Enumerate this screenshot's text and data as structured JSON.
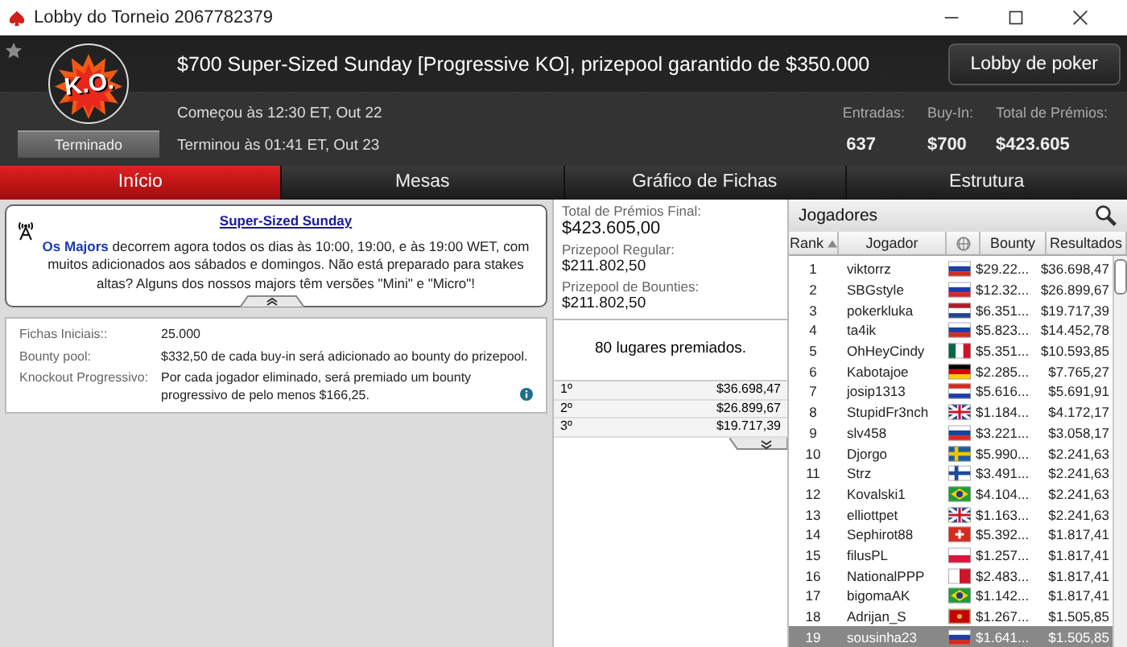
{
  "window": {
    "title": "Lobby do Torneio 2067782379"
  },
  "header": {
    "logo_text": "K.O.",
    "status": "Terminado",
    "title": "$700 Super-Sized Sunday [Progressive KO], prizepool garantido de $350.000",
    "lobby_button": "Lobby de poker",
    "started": "Começou às 12:30 ET, Out 22",
    "ended": "Terminou às 01:41 ET, Out 23",
    "stats": [
      {
        "label": "Entradas:",
        "value": "637"
      },
      {
        "label": "Buy-In:",
        "value": "$700"
      },
      {
        "label": "Total de Prémios:",
        "value": "$423.605"
      }
    ]
  },
  "tabs": [
    {
      "label": "Início",
      "selected": true
    },
    {
      "label": "Mesas",
      "selected": false
    },
    {
      "label": "Gráfico de Fichas",
      "selected": false
    },
    {
      "label": "Estrutura",
      "selected": false
    }
  ],
  "news": {
    "title": "Super-Sized Sunday",
    "link": "Os Majors",
    "text": " decorrem agora todos os dias às 10:00, 19:00, e às 19:00 WET, com muitos adicionados aos sábados e domingos. Não está preparado para stakes altas? Alguns dos nossos majors têm versões \"Mini\" e \"Micro\"!"
  },
  "details": [
    {
      "label": "Fichas Iniciais::",
      "value": "25.000",
      "info": false
    },
    {
      "label": "Bounty pool:",
      "value": "$332,50 de cada buy-in será adicionado ao bounty do prizepool.",
      "info": false
    },
    {
      "label": "Knockout Progressivo:",
      "value": "Por cada jogador eliminado, será premiado um bounty progressivo de pelo menos $166,25.",
      "info": true
    }
  ],
  "prizes": {
    "summary": [
      {
        "label": "Total de Prémios Final:",
        "value": "$423.605,00"
      },
      {
        "label": "Prizepool Regular:",
        "value": "$211.802,50"
      },
      {
        "label": "Prizepool de Bounties:",
        "value": "$211.802,50"
      }
    ],
    "places": "80 lugares premiados.",
    "payouts": [
      {
        "place": "1º",
        "amount": "$36.698,47"
      },
      {
        "place": "2º",
        "amount": "$26.899,67"
      },
      {
        "place": "3º",
        "amount": "$19.717,39"
      }
    ]
  },
  "players": {
    "title": "Jogadores",
    "columns": [
      "Rank",
      "Jogador",
      "Bounty",
      "Resultados"
    ],
    "rows": [
      {
        "rank": "1",
        "name": "viktorrz",
        "kind": "ru",
        "bounty": "$29.22...",
        "result": "$36.698,47",
        "selected": false
      },
      {
        "rank": "2",
        "name": "SBGstyle",
        "kind": "ru",
        "bounty": "$12.32...",
        "result": "$26.899,67",
        "selected": false
      },
      {
        "rank": "3",
        "name": "pokerkluka",
        "kind": "nl",
        "bounty": "$6.351...",
        "result": "$19.717,39",
        "selected": false
      },
      {
        "rank": "4",
        "name": "ta4ik",
        "kind": "ru",
        "bounty": "$5.823...",
        "result": "$14.452,78",
        "selected": false
      },
      {
        "rank": "5",
        "name": "OhHeyCindy",
        "kind": "mx",
        "bounty": "$5.351...",
        "result": "$10.593,85",
        "selected": false
      },
      {
        "rank": "6",
        "name": "Kabotajoe",
        "kind": "de",
        "bounty": "$2.285...",
        "result": "$7.765,27",
        "selected": false
      },
      {
        "rank": "7",
        "name": "josip1313",
        "kind": "hr",
        "bounty": "$5.616...",
        "result": "$5.691,91",
        "selected": false
      },
      {
        "rank": "8",
        "name": "StupidFr3nch",
        "kind": "gb",
        "bounty": "$1.184...",
        "result": "$4.172,17",
        "selected": false
      },
      {
        "rank": "9",
        "name": "slv458",
        "kind": "ru",
        "bounty": "$3.221...",
        "result": "$3.058,17",
        "selected": false
      },
      {
        "rank": "10",
        "name": "Djorgo",
        "kind": "se",
        "bounty": "$5.990...",
        "result": "$2.241,63",
        "selected": false
      },
      {
        "rank": "11",
        "name": "Strz",
        "kind": "fi",
        "bounty": "$3.491...",
        "result": "$2.241,63",
        "selected": false
      },
      {
        "rank": "12",
        "name": "Kovalski1",
        "kind": "br",
        "bounty": "$4.104...",
        "result": "$2.241,63",
        "selected": false
      },
      {
        "rank": "13",
        "name": "elliottpet",
        "kind": "gb",
        "bounty": "$1.163...",
        "result": "$2.241,63",
        "selected": false
      },
      {
        "rank": "14",
        "name": "Sephirot88",
        "kind": "ch",
        "bounty": "$5.392...",
        "result": "$1.817,41",
        "selected": false
      },
      {
        "rank": "15",
        "name": "filusPL",
        "kind": "pl",
        "bounty": "$1.257...",
        "result": "$1.817,41",
        "selected": false
      },
      {
        "rank": "16",
        "name": "NationalPPP",
        "kind": "mt",
        "bounty": "$2.483...",
        "result": "$1.817,41",
        "selected": false
      },
      {
        "rank": "17",
        "name": "bigomaAK",
        "kind": "br",
        "bounty": "$1.142...",
        "result": "$1.817,41",
        "selected": false
      },
      {
        "rank": "18",
        "name": "Adrijan_S",
        "kind": "me",
        "bounty": "$1.267...",
        "result": "$1.505,85",
        "selected": false
      },
      {
        "rank": "19",
        "name": "sousinha23",
        "kind": "sk",
        "bounty": "$1.641...",
        "result": "$1.505,85",
        "selected": true
      }
    ]
  }
}
